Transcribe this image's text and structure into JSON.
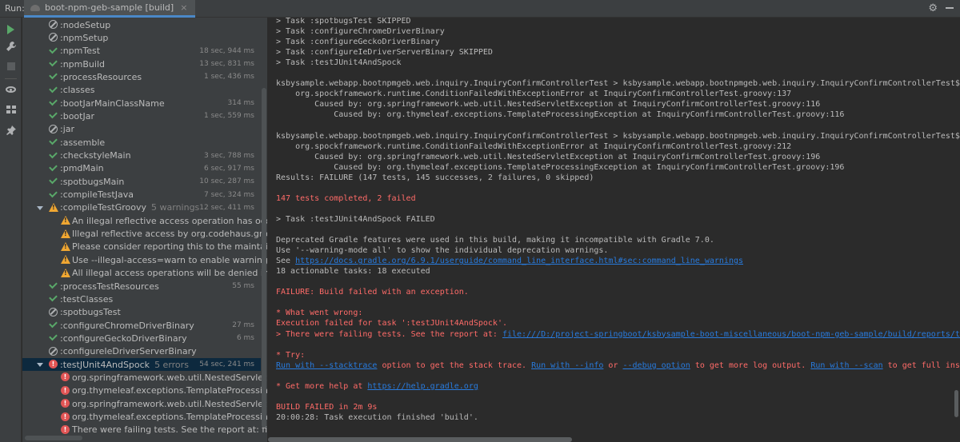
{
  "window": {
    "run_label": "Run:",
    "tab_title": "boot-npm-geb-sample [build]",
    "tab_close": "×"
  },
  "toolstrip": {
    "icons": [
      "play-icon",
      "wrench-icon",
      "stop-icon",
      "eye-icon",
      "layout-icon",
      "pin-icon"
    ]
  },
  "tree": {
    "rows": [
      {
        "label": ":nodeSetup",
        "status": "skipped",
        "duration": ""
      },
      {
        "label": ":npmSetup",
        "status": "skipped",
        "duration": ""
      },
      {
        "label": ":npmTest",
        "status": "passed",
        "duration": "18 sec, 944 ms"
      },
      {
        "label": ":npmBuild",
        "status": "passed",
        "duration": "13 sec, 831 ms"
      },
      {
        "label": ":processResources",
        "status": "passed",
        "duration": "1 sec, 436 ms"
      },
      {
        "label": ":classes",
        "status": "passed",
        "duration": ""
      },
      {
        "label": ":bootJarMainClassName",
        "status": "passed",
        "duration": "314 ms"
      },
      {
        "label": ":bootJar",
        "status": "passed",
        "duration": "1 sec, 559 ms"
      },
      {
        "label": ":jar",
        "status": "skipped",
        "duration": ""
      },
      {
        "label": ":assemble",
        "status": "passed",
        "duration": ""
      },
      {
        "label": ":checkstyleMain",
        "status": "passed",
        "duration": "3 sec, 788 ms"
      },
      {
        "label": ":pmdMain",
        "status": "passed",
        "duration": "6 sec, 917 ms"
      },
      {
        "label": ":spotbugsMain",
        "status": "passed",
        "duration": "10 sec, 287 ms"
      },
      {
        "label": ":compileTestJava",
        "status": "passed",
        "duration": "7 sec, 324 ms"
      },
      {
        "label": ":compileTestGroovy",
        "count": "5 warnings",
        "status": "warning",
        "duration": "12 sec, 411 ms",
        "expanded": true
      },
      {
        "label": "An illegal reflective access operation has occurred",
        "status": "warning",
        "child": true
      },
      {
        "label": "Illegal reflective access by org.codehaus.groovy.reflect",
        "status": "warning",
        "child": true
      },
      {
        "label": "Please consider reporting this to the maintainers of or",
        "status": "warning",
        "child": true
      },
      {
        "label": "Use --illegal-access=warn to enable warnings of furthe",
        "status": "warning",
        "child": true
      },
      {
        "label": "All illegal access operations will be denied in a future",
        "status": "warning",
        "child": true
      },
      {
        "label": ":processTestResources",
        "status": "passed",
        "duration": "55 ms"
      },
      {
        "label": ":testClasses",
        "status": "passed",
        "duration": ""
      },
      {
        "label": ":spotbugsTest",
        "status": "skipped",
        "duration": ""
      },
      {
        "label": ":configureChromeDriverBinary",
        "status": "passed",
        "duration": "27 ms"
      },
      {
        "label": ":configureGeckoDriverBinary",
        "status": "passed",
        "duration": "6 ms"
      },
      {
        "label": ":configureIeDriverServerBinary",
        "status": "skipped",
        "duration": ""
      },
      {
        "label": ":testJUnit4AndSpock",
        "count": "5 errors",
        "status": "error",
        "duration": "54 sec, 241 ms",
        "expanded": true
      },
      {
        "label": "org.springframework.web.util.NestedServletException",
        "status": "error",
        "child": true
      },
      {
        "label": "org.thymeleaf.exceptions.TemplateProcessingExceptic",
        "status": "error",
        "child": true
      },
      {
        "label": "org.springframework.web.util.NestedServletException",
        "status": "error",
        "child": true
      },
      {
        "label": "org.thymeleaf.exceptions.TemplateProcessingExceptic",
        "status": "error",
        "child": true
      },
      {
        "label": "There were failing tests. See the report at: file:///D:/pr",
        "status": "error",
        "child": true
      }
    ]
  },
  "console": {
    "lines": [
      {
        "text": "> Task :spotbugsTest SKIPPED",
        "style": "normal"
      },
      {
        "text": "> Task :configureChromeDriverBinary",
        "style": "normal"
      },
      {
        "text": "> Task :configureGeckoDriverBinary",
        "style": "normal"
      },
      {
        "text": "> Task :configureIeDriverServerBinary SKIPPED",
        "style": "normal"
      },
      {
        "text": "> Task :testJUnit4AndSpock",
        "style": "normal"
      },
      {
        "text": "",
        "style": "normal"
      },
      {
        "text": "ksbysample.webapp.bootnpmgeb.web.inquiry.InquiryConfirmControllerTest > ksbysample.webapp.bootnpmgeb.web.inquiry.InquiryConfirmControllerTest$確認",
        "style": "normal"
      },
      {
        "text": "    org.spockframework.runtime.ConditionFailedWithExceptionError at InquiryConfirmControllerTest.groovy:137",
        "style": "normal"
      },
      {
        "text": "        Caused by: org.springframework.web.util.NestedServletException at InquiryConfirmControllerTest.groovy:116",
        "style": "normal"
      },
      {
        "text": "            Caused by: org.thymeleaf.exceptions.TemplateProcessingException at InquiryConfirmControllerTest.groovy:116",
        "style": "normal"
      },
      {
        "text": "",
        "style": "normal"
      },
      {
        "text": "ksbysample.webapp.bootnpmgeb.web.inquiry.InquiryConfirmControllerTest > ksbysample.webapp.bootnpmgeb.web.inquiry.InquiryConfirmControllerTest$確認",
        "style": "normal"
      },
      {
        "text": "    org.spockframework.runtime.ConditionFailedWithExceptionError at InquiryConfirmControllerTest.groovy:212",
        "style": "normal"
      },
      {
        "text": "        Caused by: org.springframework.web.util.NestedServletException at InquiryConfirmControllerTest.groovy:196",
        "style": "normal"
      },
      {
        "text": "            Caused by: org.thymeleaf.exceptions.TemplateProcessingException at InquiryConfirmControllerTest.groovy:196",
        "style": "normal"
      },
      {
        "text": "Results: FAILURE (147 tests, 145 successes, 2 failures, 0 skipped)",
        "style": "normal"
      },
      {
        "text": "",
        "style": "normal"
      },
      {
        "text": "147 tests completed, 2 failed",
        "style": "red"
      },
      {
        "text": "",
        "style": "normal"
      },
      {
        "text": "> Task :testJUnit4AndSpock FAILED",
        "style": "normal"
      },
      {
        "text": "",
        "style": "normal"
      },
      {
        "text": "Deprecated Gradle features were used in this build, making it incompatible with Gradle 7.0.",
        "style": "normal"
      },
      {
        "text": "Use '--warning-mode all' to show the individual deprecation warnings.",
        "style": "normal"
      },
      {
        "prefix": "See ",
        "link": "https://docs.gradle.org/6.9.1/userguide/command_line_interface.html#sec:command_line_warnings",
        "style": "normal"
      },
      {
        "text": "18 actionable tasks: 18 executed",
        "style": "normal"
      },
      {
        "text": "",
        "style": "normal"
      },
      {
        "text": "FAILURE: Build failed with an exception.",
        "style": "red"
      },
      {
        "text": "",
        "style": "normal"
      },
      {
        "text": "* What went wrong:",
        "style": "red"
      },
      {
        "text": "Execution failed for task ':testJUnit4AndSpock'.",
        "style": "red"
      },
      {
        "prefix": "> There were failing tests. See the report at: ",
        "link": "file:///D:/project-springboot/ksbysample-boot-miscellaneous/boot-npm-geb-sample/build/reports/tests",
        "style": "red"
      },
      {
        "text": "",
        "style": "normal"
      },
      {
        "text": "* Try:",
        "style": "red"
      },
      {
        "parts": [
          {
            "t": "Run with --stacktrace",
            "link": true
          },
          {
            "t": " option to get the stack trace. ",
            "link": false
          },
          {
            "t": "Run with --info",
            "link": true
          },
          {
            "t": " or ",
            "link": false
          },
          {
            "t": "--debug option",
            "link": true
          },
          {
            "t": " to get more log output. ",
            "link": false
          },
          {
            "t": "Run with --scan",
            "link": true
          },
          {
            "t": " to get full insigh",
            "link": false
          }
        ],
        "style": "red"
      },
      {
        "text": "",
        "style": "normal"
      },
      {
        "prefix": "* Get more help at ",
        "link": "https://help.gradle.org",
        "style": "red"
      },
      {
        "text": "",
        "style": "normal"
      },
      {
        "text": "BUILD FAILED in 2m 9s",
        "style": "red"
      },
      {
        "text": "20:00:28: Task execution finished 'build'.",
        "style": "normal"
      }
    ]
  },
  "colors": {
    "passed": "#59a869",
    "warning": "#f0a732",
    "error": "#e05555",
    "console_red": "#ff6b68",
    "link": "#287bde"
  }
}
